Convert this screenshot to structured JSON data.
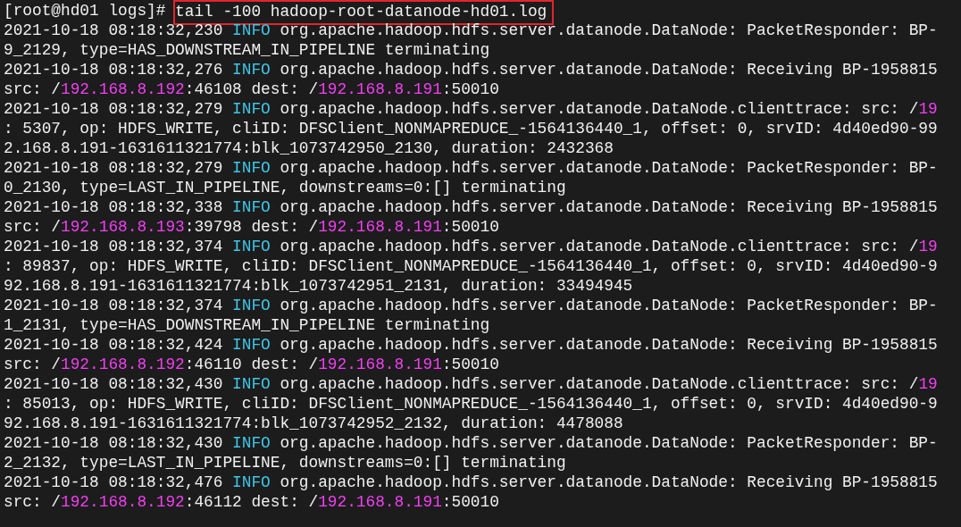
{
  "terminal": {
    "lines": [
      {
        "segments": [
          {
            "kind": "prompt",
            "text": "[root@hd01 logs]# "
          },
          {
            "kind": "command",
            "text": "tail -100 hadoop-root-datanode-hd01.log",
            "highlighted": true
          }
        ]
      },
      {
        "segments": [
          {
            "kind": "text",
            "text": "2021-10-18 08:18:32,230 "
          },
          {
            "kind": "level",
            "text": "INFO"
          },
          {
            "kind": "text",
            "text": " org.apache.hadoop.hdfs.server.datanode.DataNode: PacketResponder: BP-"
          }
        ]
      },
      {
        "segments": [
          {
            "kind": "text",
            "text": "9_2129, type=HAS_DOWNSTREAM_IN_PIPELINE terminating"
          }
        ]
      },
      {
        "segments": [
          {
            "kind": "text",
            "text": "2021-10-18 08:18:32,276 "
          },
          {
            "kind": "level",
            "text": "INFO"
          },
          {
            "kind": "text",
            "text": " org.apache.hadoop.hdfs.server.datanode.DataNode: Receiving BP-1958815"
          }
        ]
      },
      {
        "segments": [
          {
            "kind": "text",
            "text": "src: /"
          },
          {
            "kind": "ip",
            "text": "192.168.8.192"
          },
          {
            "kind": "text",
            "text": ":46108 dest: /"
          },
          {
            "kind": "ip",
            "text": "192.168.8.191"
          },
          {
            "kind": "text",
            "text": ":50010"
          }
        ]
      },
      {
        "segments": [
          {
            "kind": "text",
            "text": "2021-10-18 08:18:32,279 "
          },
          {
            "kind": "level",
            "text": "INFO"
          },
          {
            "kind": "text",
            "text": " org.apache.hadoop.hdfs.server.datanode.DataNode.clienttrace: src: /"
          },
          {
            "kind": "ip",
            "text": "19"
          }
        ]
      },
      {
        "segments": [
          {
            "kind": "text",
            "text": ": 5307, op: HDFS_WRITE, cliID: DFSClient_NONMAPREDUCE_-1564136440_1, offset: 0, srvID: 4d40ed90-99"
          }
        ]
      },
      {
        "segments": [
          {
            "kind": "text",
            "text": "2.168.8.191-1631611321774:blk_1073742950_2130, duration: 2432368"
          }
        ]
      },
      {
        "segments": [
          {
            "kind": "text",
            "text": "2021-10-18 08:18:32,279 "
          },
          {
            "kind": "level",
            "text": "INFO"
          },
          {
            "kind": "text",
            "text": " org.apache.hadoop.hdfs.server.datanode.DataNode: PacketResponder: BP-"
          }
        ]
      },
      {
        "segments": [
          {
            "kind": "text",
            "text": "0_2130, type=LAST_IN_PIPELINE, downstreams=0:[] terminating"
          }
        ]
      },
      {
        "segments": [
          {
            "kind": "text",
            "text": "2021-10-18 08:18:32,338 "
          },
          {
            "kind": "level",
            "text": "INFO"
          },
          {
            "kind": "text",
            "text": " org.apache.hadoop.hdfs.server.datanode.DataNode: Receiving BP-1958815"
          }
        ]
      },
      {
        "segments": [
          {
            "kind": "text",
            "text": "src: /"
          },
          {
            "kind": "ip",
            "text": "192.168.8.193"
          },
          {
            "kind": "text",
            "text": ":39798 dest: /"
          },
          {
            "kind": "ip",
            "text": "192.168.8.191"
          },
          {
            "kind": "text",
            "text": ":50010"
          }
        ]
      },
      {
        "segments": [
          {
            "kind": "text",
            "text": "2021-10-18 08:18:32,374 "
          },
          {
            "kind": "level",
            "text": "INFO"
          },
          {
            "kind": "text",
            "text": " org.apache.hadoop.hdfs.server.datanode.DataNode.clienttrace: src: /"
          },
          {
            "kind": "ip",
            "text": "19"
          }
        ]
      },
      {
        "segments": [
          {
            "kind": "text",
            "text": ": 89837, op: HDFS_WRITE, cliID: DFSClient_NONMAPREDUCE_-1564136440_1, offset: 0, srvID: 4d40ed90-9"
          }
        ]
      },
      {
        "segments": [
          {
            "kind": "text",
            "text": "92.168.8.191-1631611321774:blk_1073742951_2131, duration: 33494945"
          }
        ]
      },
      {
        "segments": [
          {
            "kind": "text",
            "text": "2021-10-18 08:18:32,374 "
          },
          {
            "kind": "level",
            "text": "INFO"
          },
          {
            "kind": "text",
            "text": " org.apache.hadoop.hdfs.server.datanode.DataNode: PacketResponder: BP-"
          }
        ]
      },
      {
        "segments": [
          {
            "kind": "text",
            "text": "1_2131, type=HAS_DOWNSTREAM_IN_PIPELINE terminating"
          }
        ]
      },
      {
        "segments": [
          {
            "kind": "text",
            "text": "2021-10-18 08:18:32,424 "
          },
          {
            "kind": "level",
            "text": "INFO"
          },
          {
            "kind": "text",
            "text": " org.apache.hadoop.hdfs.server.datanode.DataNode: Receiving BP-1958815"
          }
        ]
      },
      {
        "segments": [
          {
            "kind": "text",
            "text": "src: /"
          },
          {
            "kind": "ip",
            "text": "192.168.8.192"
          },
          {
            "kind": "text",
            "text": ":46110 dest: /"
          },
          {
            "kind": "ip",
            "text": "192.168.8.191"
          },
          {
            "kind": "text",
            "text": ":50010"
          }
        ]
      },
      {
        "segments": [
          {
            "kind": "text",
            "text": "2021-10-18 08:18:32,430 "
          },
          {
            "kind": "level",
            "text": "INFO"
          },
          {
            "kind": "text",
            "text": " org.apache.hadoop.hdfs.server.datanode.DataNode.clienttrace: src: /"
          },
          {
            "kind": "ip",
            "text": "19"
          }
        ]
      },
      {
        "segments": [
          {
            "kind": "text",
            "text": ": 85013, op: HDFS_WRITE, cliID: DFSClient_NONMAPREDUCE_-1564136440_1, offset: 0, srvID: 4d40ed90-9"
          }
        ]
      },
      {
        "segments": [
          {
            "kind": "text",
            "text": "92.168.8.191-1631611321774:blk_1073742952_2132, duration: 4478088"
          }
        ]
      },
      {
        "segments": [
          {
            "kind": "text",
            "text": "2021-10-18 08:18:32,430 "
          },
          {
            "kind": "level",
            "text": "INFO"
          },
          {
            "kind": "text",
            "text": " org.apache.hadoop.hdfs.server.datanode.DataNode: PacketResponder: BP-"
          }
        ]
      },
      {
        "segments": [
          {
            "kind": "text",
            "text": "2_2132, type=LAST_IN_PIPELINE, downstreams=0:[] terminating"
          }
        ]
      },
      {
        "segments": [
          {
            "kind": "text",
            "text": "2021-10-18 08:18:32,476 "
          },
          {
            "kind": "level",
            "text": "INFO"
          },
          {
            "kind": "text",
            "text": " org.apache.hadoop.hdfs.server.datanode.DataNode: Receiving BP-1958815"
          }
        ]
      },
      {
        "segments": [
          {
            "kind": "text",
            "text": "src: /"
          },
          {
            "kind": "ip",
            "text": "192.168.8.192"
          },
          {
            "kind": "text",
            "text": ":46112 dest: /"
          },
          {
            "kind": "ip",
            "text": "192.168.8.191"
          },
          {
            "kind": "text",
            "text": ":50010"
          }
        ]
      }
    ]
  }
}
